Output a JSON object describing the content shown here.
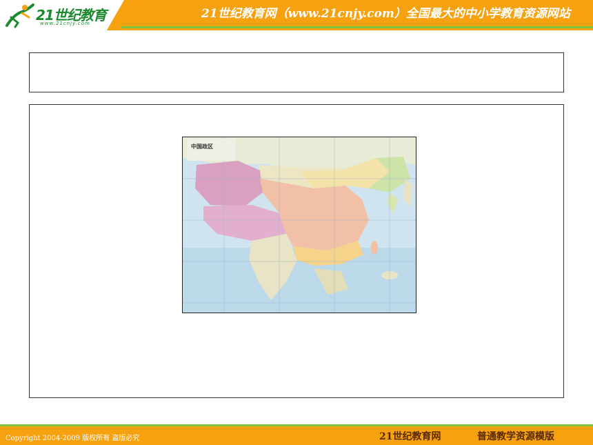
{
  "header": {
    "logo_text": "21世纪教育",
    "logo_url": "www.21cnjy.com",
    "slogan": "21世纪教育网（www.21cnjy.com）全国最大的中小学教育资源网站"
  },
  "map": {
    "title": "中国政区"
  },
  "footer": {
    "copyright": "Copyright 2004-2009 版权所有 盗版必究",
    "brand": "21世纪教育网",
    "template": "普通教学资源模版"
  },
  "colors": {
    "header_bg": "#f6a10f",
    "accent_green": "#7cc242",
    "logo_green": "#1b8a2e"
  }
}
